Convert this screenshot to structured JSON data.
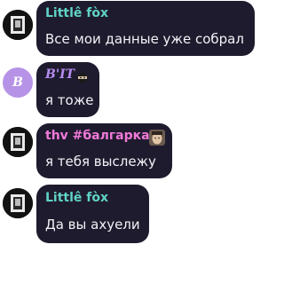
{
  "colors": {
    "bubble": "#1f1b2e",
    "name_teal": "#5fd3c5",
    "name_purple": "#b58cf0",
    "name_pink": "#f07ad8",
    "text": "#f2f2f6",
    "avatar_letter_bg": "#b693e6"
  },
  "messages": [
    {
      "author": "Littlê fòx",
      "text": "Все мои данные уже собрал",
      "avatar": "dark-photo-avatar"
    },
    {
      "author": "B'IT",
      "avatar_letter": "B",
      "text": "я тоже",
      "badge_icon": "ninja-emoji-icon"
    },
    {
      "author": "thv #балгарка",
      "text": "я тебя выслежу",
      "badge_icon": "face-photo-badge",
      "avatar": "dark-photo-avatar"
    },
    {
      "author": "Littlê fòx",
      "text": "Да вы ахуели",
      "avatar": "dark-photo-avatar"
    }
  ]
}
